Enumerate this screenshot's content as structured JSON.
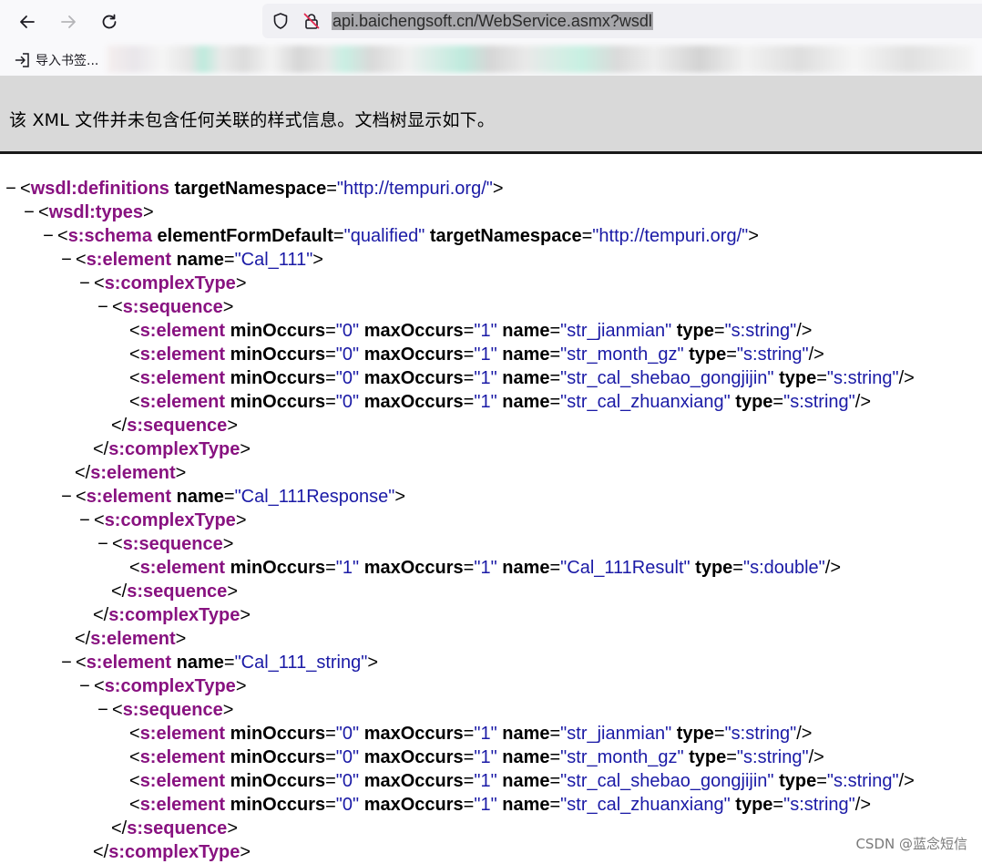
{
  "browser": {
    "url": "api.baichengsoft.cn/WebService.asmx?wsdl",
    "bookmark_import_label": "导入书签...",
    "icons": [
      "back-arrow-icon",
      "forward-arrow-icon",
      "reload-icon",
      "shield-icon",
      "insecure-lock-icon",
      "import-icon"
    ]
  },
  "notice": {
    "text": "该 XML 文件并未包含任何关联的样式信息。文档树显示如下。"
  },
  "colors": {
    "tag": "#881280",
    "attr_value": "#1a1aa6",
    "notice_bg": "#d9d9d9"
  },
  "tree": {
    "definitions": {
      "tag": "wsdl:definitions",
      "attr": "targetNamespace",
      "value": "http://tempuri.org/"
    },
    "types": {
      "tag": "wsdl:types"
    },
    "schema": {
      "tag": "s:schema",
      "attr1": "elementFormDefault",
      "value1": "qualified",
      "attr2": "targetNamespace",
      "value2": "http://tempuri.org/"
    },
    "element_tag": "s:element",
    "complex_tag": "s:complexType",
    "sequence_tag": "s:sequence",
    "attr_name": "name",
    "attr_min": "minOccurs",
    "attr_max": "maxOccurs",
    "attr_type": "type",
    "elements": [
      {
        "name": "Cal_111",
        "fields": [
          {
            "min": "0",
            "max": "1",
            "name": "str_jianmian",
            "type": "s:string"
          },
          {
            "min": "0",
            "max": "1",
            "name": "str_month_gz",
            "type": "s:string"
          },
          {
            "min": "0",
            "max": "1",
            "name": "str_cal_shebao_gongjijin",
            "type": "s:string"
          },
          {
            "min": "0",
            "max": "1",
            "name": "str_cal_zhuanxiang",
            "type": "s:string"
          }
        ]
      },
      {
        "name": "Cal_111Response",
        "fields": [
          {
            "min": "1",
            "max": "1",
            "name": "Cal_111Result",
            "type": "s:double"
          }
        ]
      },
      {
        "name": "Cal_111_string",
        "fields": [
          {
            "min": "0",
            "max": "1",
            "name": "str_jianmian",
            "type": "s:string"
          },
          {
            "min": "0",
            "max": "1",
            "name": "str_month_gz",
            "type": "s:string"
          },
          {
            "min": "0",
            "max": "1",
            "name": "str_cal_shebao_gongjijin",
            "type": "s:string"
          },
          {
            "min": "0",
            "max": "1",
            "name": "str_cal_zhuanxiang",
            "type": "s:string"
          }
        ]
      }
    ]
  },
  "watermark": "CSDN @蓝念短信"
}
